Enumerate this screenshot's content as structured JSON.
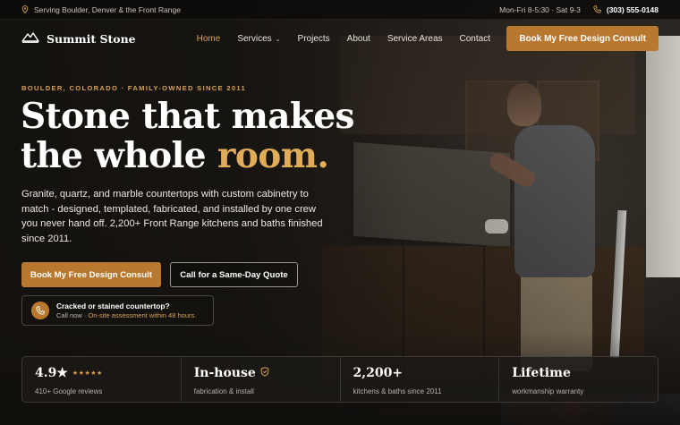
{
  "topbar": {
    "service_area": "Serving Boulder, Denver & the Front Range",
    "hours": "Mon-Fri 8-5:30 · Sat 9-3",
    "phone": "(303) 555-0148"
  },
  "brand": {
    "name": "Summit Stone",
    "logo_icon": "mountain-icon"
  },
  "nav": {
    "items": [
      {
        "label": "Home",
        "active": true
      },
      {
        "label": "Services",
        "dropdown": true
      },
      {
        "label": "Projects"
      },
      {
        "label": "About"
      },
      {
        "label": "Service Areas"
      },
      {
        "label": "Contact"
      }
    ],
    "cta": "Book My Free Design Consult"
  },
  "hero": {
    "eyebrow": "BOULDER, COLORADO · FAMILY-OWNED SINCE 2011",
    "headline_line1": "Stone that makes",
    "headline_line2_plain": "the whole",
    "headline_line2_accent": "room.",
    "lede": "Granite, quartz, and marble countertops with custom cabinetry installed by one crew you never hand off. 2,200+ Front Range kitchens and baths finished since 2011.",
    "lede_full": "Granite, quartz, and marble countertops with custom cabinetry to match - designed, templated, fabricated, and installed by one crew you never hand off. 2,200+ Front Range kitchens and baths finished since 2011.",
    "primary_cta": "Book My Free Design Consult",
    "secondary_cta": "Call for a Same-Day Quote"
  },
  "alert": {
    "icon": "phone-icon",
    "title": "Cracked or stained countertop?",
    "sub_prefix": "Call now · ",
    "sub_highlight": "On-site assessment within 48 hours."
  },
  "stats": [
    {
      "value": "4.9★",
      "stars": "★★★★★",
      "label": "410+ Google reviews"
    },
    {
      "value": "In-house",
      "badge_icon": "shield-check-icon",
      "label": "fabrication & install"
    },
    {
      "value": "2,200+",
      "label": "kitchens & baths since 2011"
    },
    {
      "value": "Lifetime",
      "label": "workmanship warranty"
    }
  ],
  "colors": {
    "accent": "#b9782f",
    "accent_text": "#d9a24e",
    "background": "#1c1a17"
  }
}
